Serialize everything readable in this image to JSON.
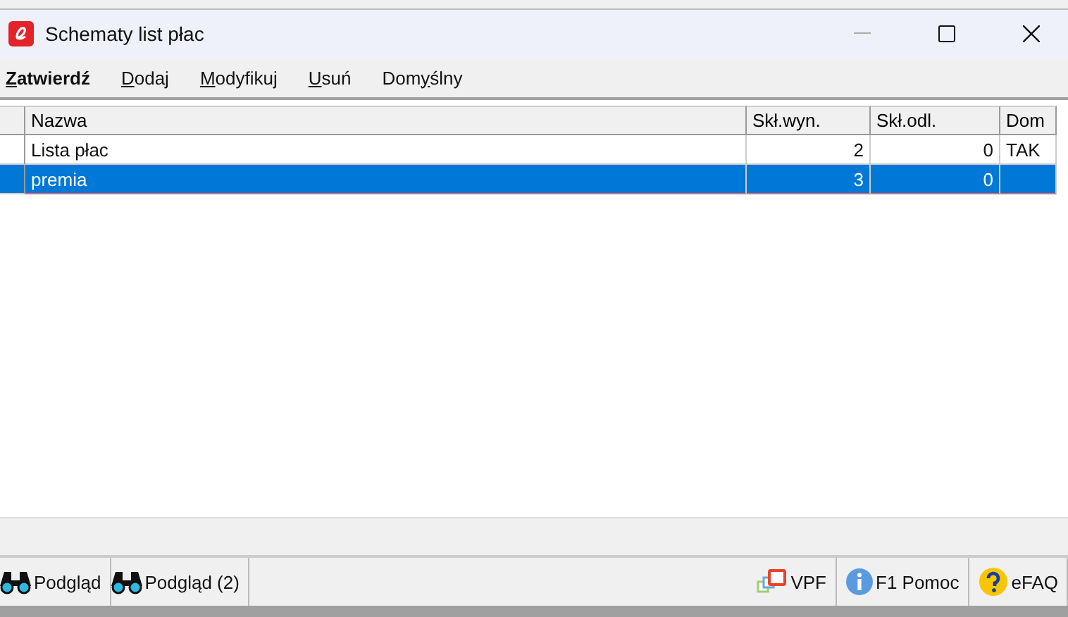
{
  "window": {
    "title": "Schematy list płac"
  },
  "menu": [
    {
      "key": "Z",
      "post": "atwierdź",
      "bold": true
    },
    {
      "key": "D",
      "post": "odaj",
      "bold": false
    },
    {
      "key": "M",
      "post": "odyfikuj",
      "bold": false
    },
    {
      "key": "U",
      "post": "suń",
      "bold": false
    },
    {
      "pre": "Dom",
      "key": "y",
      "post": "ślny",
      "bold": false
    }
  ],
  "table": {
    "columns": [
      "Nazwa",
      "Skł.wyn.",
      "Skł.odl.",
      "Dom"
    ],
    "rows": [
      {
        "cells": [
          "Lista płac",
          "2",
          "0",
          "TAK"
        ],
        "selected": false
      },
      {
        "cells": [
          "premia",
          "3",
          "0",
          ""
        ],
        "selected": true
      }
    ]
  },
  "footer_left": [
    {
      "label": "Podgląd"
    },
    {
      "label": "Podgląd (2)"
    }
  ],
  "footer_right": [
    {
      "label": "VPF",
      "kind": "vpf"
    },
    {
      "label": "F1 Pomoc",
      "kind": "help"
    },
    {
      "label": "eFAQ",
      "kind": "faq"
    }
  ]
}
